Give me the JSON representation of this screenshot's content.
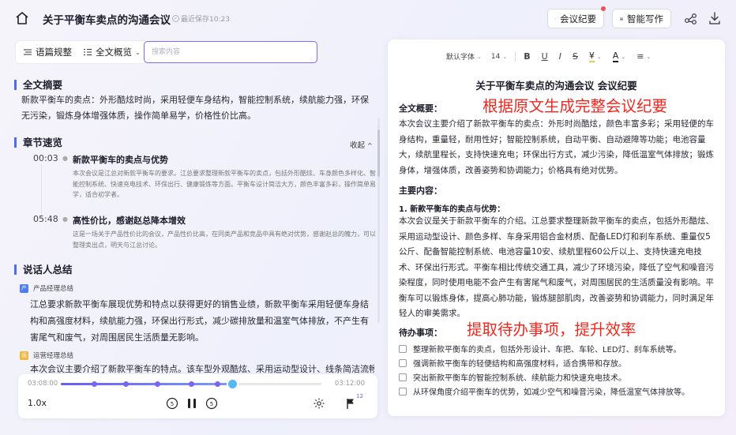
{
  "header": {
    "title": "关于平衡车卖点的沟通会议",
    "save_status": "最近保存10:23",
    "minutes_label": "会议纪要",
    "write_label": "智能写作"
  },
  "left": {
    "toolbar": {
      "regulate_label": "语篇规整",
      "overview_label": "全文概览"
    },
    "search_placeholder": "搜索内容",
    "summary_title": "全文摘要",
    "summary_text": "新款平衡车的卖点：外形酷炫时尚，采用轻便车身结构，智能控制系统，续航能力强，环保无污染，锻炼身体增强体质，操作简单易学，价格性价比高。",
    "chapters_title": "章节速览",
    "collapse_label": "收起",
    "chapters": [
      {
        "time": "00:03",
        "title": "新款平衡车的卖点与优势",
        "desc": "本次会议是江总对新款平衡车的要求。江总要求整理新款平衡车的卖点，包括外形酷炫、车身颜色多样化、智能控制系统、快速充电技术、环保出行、健康锻炼等方面。平衡车设计简洁大方，颜色丰富多彩，操作简单易学，适合初学者。"
      },
      {
        "time": "05:48",
        "title": "高性价比，感谢赵总降本增效",
        "desc": "这是一场关于产品性价比的会议，产品性价比高，在同类产品和竞品中具有绝对优势，感谢赵总的魄力，可以整理卖出点，明天与江总讨论。"
      }
    ],
    "speakers_title": "说话人总结",
    "speakers": [
      {
        "name": "产品经理总结",
        "text": "江总要求新款平衡车展现优势和特点以获得更好的销售业绩，新款平衡车采用轻便车身结构和高强度材料，续航能力强，环保出行形式，减少碳排放量和温室气体排放，不产生有害尾气和废气，对周围居民生活质量无影响。"
      },
      {
        "name": "运营经理总结",
        "text": "本次会议主要介绍了新款平衡车的特点。该车型外观酷炫、采用运动型设计、线条简洁流畅，颜色多"
      }
    ]
  },
  "player": {
    "current_time": "03:08:00",
    "total_time": "03:12:00",
    "progress": 0.66,
    "markers": [
      0.13,
      0.25,
      0.37,
      0.5,
      0.6
    ],
    "speed": "1.0x",
    "mark_count": "12"
  },
  "right": {
    "format": {
      "font": "默认字体",
      "size": "14",
      "bold": "B",
      "underline": "U",
      "italic": "I",
      "strike": "S",
      "highlight": "¥",
      "color": "A",
      "align": "≡"
    },
    "doc_title": "关于平衡车卖点的沟通会议 会议纪要",
    "overview_heading": "全文概要：",
    "annotation_1": "根据原文生成完整会议纪要",
    "overview_text": "本次会议主要介绍了新款平衡车的卖点：外形时尚酷炫，颜色丰富多彩；采用轻便的车身结构，重量轻，耐用性好；智能控制系统，自动平衡、自动避障等功能；电池容量大，续航里程长，支持快速充电；环保出行方式，减少污染，降低温室气体排放；锻炼身体，增强体质，改善姿势和协调能力；价格具有绝对优势。",
    "main_heading": "主要内容：",
    "main_sub": "1. 新款平衡车的卖点与优势：",
    "main_text": "本次会议是关于新款平衡车的介绍。江总要求整理新款平衡车的卖点，包括外形酷炫、采用运动型设计、颜色多样、车身采用铝合金材质、配备LED灯和刹车系统、重量仅5公斤、配备智能控制系统、电池容量10安、续航里程60公斤以上、支持快速充电技术、环保出行形式。平衡车相比传统交通工具，减少了环境污染，降低了空气和噪音污染程度，同时使用电能不会产生有害尾气和废气，对周围居民的生活质量没有影响。平衡车可以锻炼身体，提高心肺功能，锻炼腿部肌肉，改善姿势和协调能力，同时满足年轻人的审美需求。",
    "todo_heading": "待办事项：",
    "annotation_2": "提取待办事项，提升效率",
    "todos": [
      "整理新款平衡车的卖点，包括外形设计、车把、车轮、LED灯、刹车系统等。",
      "强调新款平衡车的轻便结构和高强度材料，适合携带和存放。",
      "突出新款平衡车的智能控制系统、续航能力和快速充电技术。",
      "从环保角度介绍平衡车的优势，如减少空气和噪音污染，降低温室气体排放等。"
    ]
  },
  "colors": {
    "accent": "#4a6cf7",
    "purple": "#7a64f0",
    "annotation_red": "#f0271f",
    "notification_dot": "#f24f4f"
  },
  "icons": [
    "home-icon",
    "check-circle-icon",
    "minutes-icon",
    "ai-write-icon",
    "share-icon",
    "download-icon",
    "regulate-icon",
    "overview-icon",
    "rewind-icon",
    "pause-icon",
    "forward-icon",
    "settings-icon",
    "flag-icon"
  ]
}
